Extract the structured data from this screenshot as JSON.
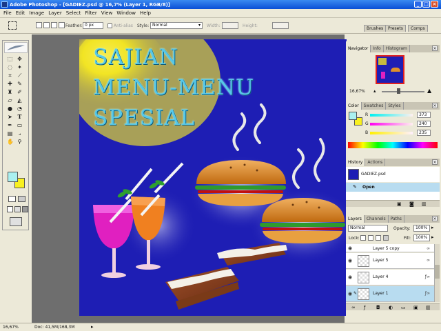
{
  "window": {
    "title": "Adobe Photoshop - [GADIEZ.psd @ 16,7% (Layer 1, RGB/8)]",
    "minimize": "_",
    "maximize": "□",
    "close": "×"
  },
  "menu": [
    "File",
    "Edit",
    "Image",
    "Layer",
    "Select",
    "Filter",
    "View",
    "Window",
    "Help"
  ],
  "options": {
    "feather_label": "Feather:",
    "feather_value": "0 px",
    "antialias_label": "Anti-alias",
    "style_label": "Style:",
    "style_value": "Normal",
    "width_label": "Width:",
    "height_label": "Height:"
  },
  "well_tabs": [
    "Brushes",
    "Presets",
    "Comps"
  ],
  "artwork": {
    "line1": "SAJIAN",
    "line2": "MENU-MENU",
    "line3": "SPESIAL"
  },
  "navigator": {
    "tabs": [
      "Navigator",
      "Info",
      "Histogram"
    ],
    "zoom": "16,67%"
  },
  "color": {
    "tabs": [
      "Color",
      "Swatches",
      "Styles"
    ],
    "r_label": "R",
    "g_label": "G",
    "b_label": "B",
    "r_value": "373",
    "g_value": "240",
    "b_value": "235",
    "foreground": "#aaf0f0",
    "background": "#f8f020"
  },
  "history": {
    "tabs": [
      "History",
      "Actions"
    ],
    "snapshot": "GADIEZ.psd",
    "step": "Open"
  },
  "layers": {
    "tabs": [
      "Layers",
      "Channels",
      "Paths"
    ],
    "blend_mode": "Normal",
    "opacity_label": "Opacity:",
    "opacity_value": "100%",
    "lock_label": "Lock:",
    "fill_label": "Fill:",
    "fill_value": "100%",
    "rows": [
      {
        "name": "Layer 5 copy"
      },
      {
        "name": "Layer 5"
      },
      {
        "name": "Layer 4"
      },
      {
        "name": "Layer 1"
      }
    ]
  },
  "status": {
    "zoom": "16,67%",
    "doc": "Doc: 41,5M/168,3M"
  },
  "accent": "#0a4fd6",
  "canvas_bg": "#1e1eb4"
}
